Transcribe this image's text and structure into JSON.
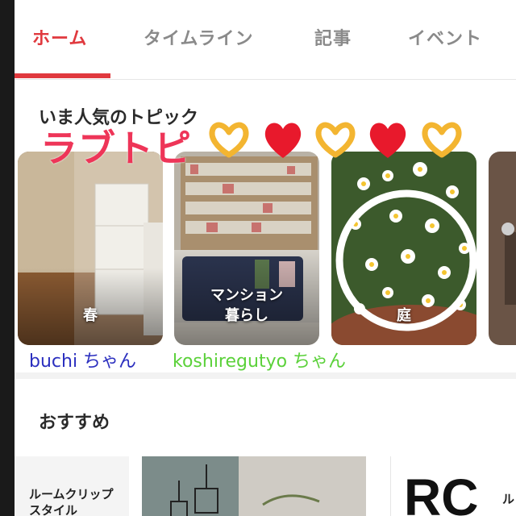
{
  "tabs": [
    {
      "label": "ホーム",
      "active": true
    },
    {
      "label": "タイムライン",
      "active": false
    },
    {
      "label": "記事",
      "active": false
    },
    {
      "label": "イベント",
      "active": false
    }
  ],
  "trending": {
    "title": "いま人気のトピック",
    "overlay_text": "ラブトピ",
    "cards": [
      {
        "label_line1": "春",
        "label_line2": ""
      },
      {
        "label_line1": "マンション",
        "label_line2": "暮らし"
      },
      {
        "label_line1": "庭",
        "label_line2": ""
      }
    ],
    "users": [
      {
        "name": "buchi ちゃん",
        "color": "#2b2fbf"
      },
      {
        "name": "koshiregutyo ちゃん",
        "color": "#5bd13a"
      }
    ]
  },
  "recommend": {
    "title": "おすすめ",
    "card1_line1": "ルームクリップ",
    "card1_line2": "スタイル",
    "card3_text": "RC",
    "card3_side": "ル"
  },
  "colors": {
    "accent": "#e0393e",
    "overlay": "#ee3558"
  },
  "icons": [
    "hand-heart-icon",
    "red-heart-icon"
  ]
}
